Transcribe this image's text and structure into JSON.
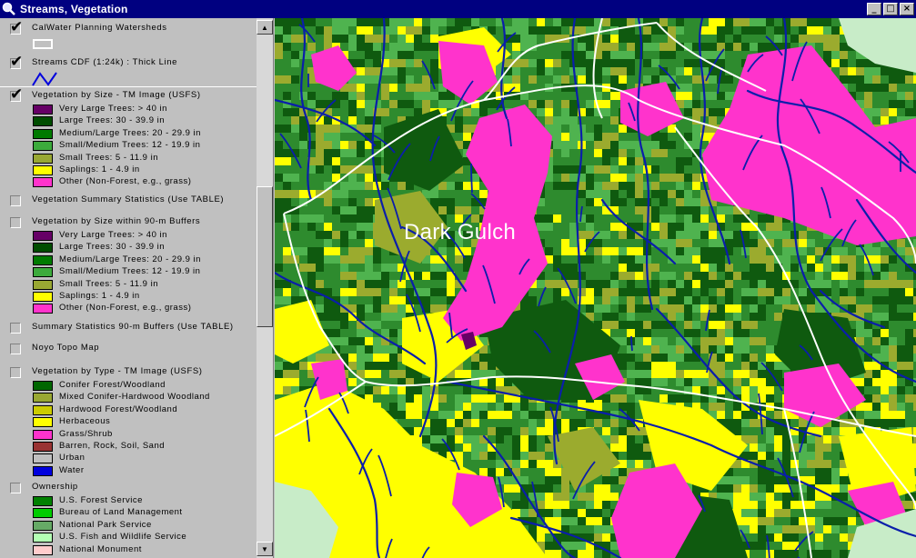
{
  "window": {
    "title": "Streams, Vegetation"
  },
  "map": {
    "place_label": "Dark Gulch"
  },
  "legend": {
    "themes": [
      {
        "name": "CalWater Planning Watersheds",
        "checked": true,
        "items": []
      },
      {
        "name": "Streams CDF (1:24k) : Thick Line",
        "checked": true,
        "items": []
      },
      {
        "name": "Vegetation by Size - TM Image (USFS)",
        "checked": true,
        "items": [
          {
            "label": "Very Large Trees: > 40  in",
            "color": "#660066"
          },
          {
            "label": "Large Trees: 30 - 39.9 in",
            "color": "#004d00"
          },
          {
            "label": "Medium/Large Trees: 20 - 29.9 in",
            "color": "#007a00"
          },
          {
            "label": "Small/Medium Trees: 12 - 19.9 in",
            "color": "#3cab3c"
          },
          {
            "label": "Small Trees: 5 - 11.9 in",
            "color": "#99a833"
          },
          {
            "label": "Saplings: 1 - 4.9 in",
            "color": "#ffff00"
          },
          {
            "label": "Other (Non-Forest, e.g., grass)",
            "color": "#ff33cc"
          }
        ]
      },
      {
        "name": "Vegetation Summary Statistics (Use TABLE)",
        "checked": false,
        "items": []
      },
      {
        "name": "Vegetation by Size within 90-m Buffers",
        "checked": false,
        "items": [
          {
            "label": "Very Large Trees: > 40  in",
            "color": "#660066"
          },
          {
            "label": "Large Trees: 30 - 39.9 in",
            "color": "#004d00"
          },
          {
            "label": "Medium/Large Trees: 20 - 29.9 in",
            "color": "#007a00"
          },
          {
            "label": "Small/Medium Trees: 12 - 19.9 in",
            "color": "#3cab3c"
          },
          {
            "label": "Small Trees: 5 - 11.9 in",
            "color": "#99a833"
          },
          {
            "label": "Saplings: 1 - 4.9 in",
            "color": "#ffff00"
          },
          {
            "label": "Other (Non-Forest, e.g., grass)",
            "color": "#ff33cc"
          }
        ]
      },
      {
        "name": "Summary Statistics 90-m Buffers (Use TABLE)",
        "checked": false,
        "items": []
      },
      {
        "name": "Noyo Topo Map",
        "checked": false,
        "items": []
      },
      {
        "name": "Vegetation by Type - TM Image (USFS)",
        "checked": false,
        "items": [
          {
            "label": "Conifer Forest/Woodland",
            "color": "#006600"
          },
          {
            "label": "Mixed Conifer-Hardwood Woodland",
            "color": "#99a833"
          },
          {
            "label": "Hardwood Forest/Woodland",
            "color": "#cccc00"
          },
          {
            "label": "Herbaceous",
            "color": "#ffff00"
          },
          {
            "label": "Grass/Shrub",
            "color": "#ff33cc"
          },
          {
            "label": "Barren, Rock, Soil, Sand",
            "color": "#993333"
          },
          {
            "label": "Urban",
            "color": "#c0c0c0"
          },
          {
            "label": "Water",
            "color": "#0000dd"
          }
        ]
      },
      {
        "name": "Ownership",
        "checked": false,
        "items": [
          {
            "label": "U.S. Forest Service",
            "color": "#008000"
          },
          {
            "label": "Bureau of Land Management",
            "color": "#00cc00"
          },
          {
            "label": "National Park Service",
            "color": "#66aa66"
          },
          {
            "label": "U.S. Fish and Wildlife Service",
            "color": "#b3ffb3"
          },
          {
            "label": "National Monument",
            "color": "#ffcccc"
          }
        ]
      }
    ]
  }
}
